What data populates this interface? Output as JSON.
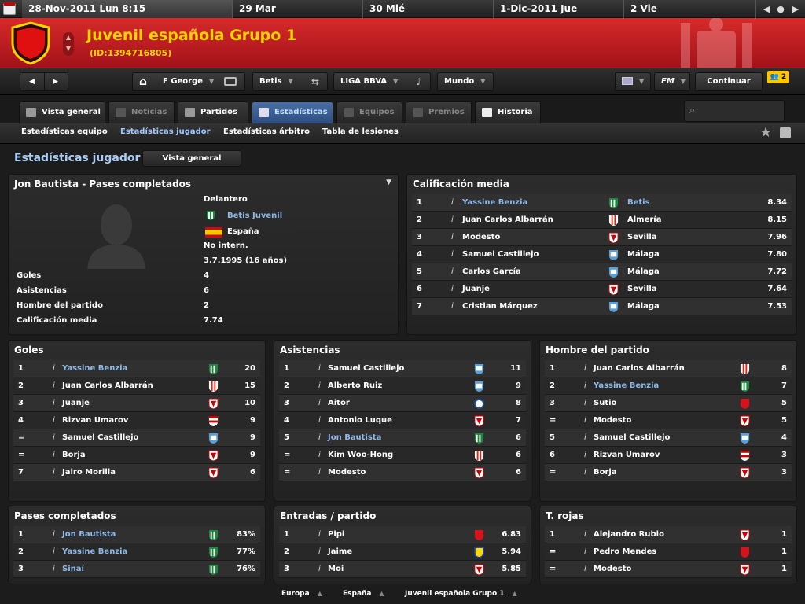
{
  "topbar": {
    "today": "28-Nov-2011 Lun 8:15",
    "dates": [
      "29 Mar",
      "30 Mié",
      "1-Dic-2011 Jue",
      "2 Vie"
    ]
  },
  "header": {
    "title": "Juvenil española Grupo 1",
    "id": "(ID:1394716805)"
  },
  "nav": {
    "manager": "F George",
    "club": "Betis",
    "league": "LIGA BBVA",
    "world": "Mundo",
    "fm": "FM",
    "continue": "Continuar",
    "badge": "2"
  },
  "tabs": [
    {
      "label": "Vista general",
      "icon": "list-icon"
    },
    {
      "label": "Noticias",
      "icon": "news-icon"
    },
    {
      "label": "Partidos",
      "icon": "calendar-icon"
    },
    {
      "label": "Estadísticas",
      "icon": "chart-icon"
    },
    {
      "label": "Equipos",
      "icon": "shield-icon"
    },
    {
      "label": "Premios",
      "icon": "trophy-icon"
    },
    {
      "label": "Historia",
      "icon": "book-icon"
    }
  ],
  "subtabs": [
    "Estadísticas equipo",
    "Estadísticas jugador",
    "Estadísticas árbitro",
    "Tabla de lesiones"
  ],
  "section": {
    "title": "Estadísticas jugador",
    "button": "Vista general"
  },
  "player": {
    "title": "Jon Bautista - Pases completados",
    "position": "Delantero",
    "club": "Betis Juvenil",
    "nation": "España",
    "intl": "No intern.",
    "dob": "3.7.1995 (16 años)",
    "stats": [
      {
        "label": "Goles",
        "value": "4"
      },
      {
        "label": "Asistencias",
        "value": "6"
      },
      {
        "label": "Hombre del partido",
        "value": "2"
      },
      {
        "label": "Calificación media",
        "value": "7.74"
      }
    ]
  },
  "rating": {
    "title": "Calificación media",
    "rows": [
      {
        "pos": "1",
        "name": "Yassine Benzia",
        "club": "Betis",
        "value": "8.34",
        "link": true,
        "crest": "betis"
      },
      {
        "pos": "2",
        "name": "Juan Carlos Albarrán",
        "club": "Almería",
        "value": "8.15",
        "link": false,
        "crest": "almeria"
      },
      {
        "pos": "3",
        "name": "Modesto",
        "club": "Sevilla",
        "value": "7.96",
        "link": false,
        "crest": "sevilla"
      },
      {
        "pos": "4",
        "name": "Samuel Castillejo",
        "club": "Málaga",
        "value": "7.80",
        "link": false,
        "crest": "malaga"
      },
      {
        "pos": "5",
        "name": "Carlos García",
        "club": "Málaga",
        "value": "7.72",
        "link": false,
        "crest": "malaga"
      },
      {
        "pos": "6",
        "name": "Juanje",
        "club": "Sevilla",
        "value": "7.64",
        "link": false,
        "crest": "sevilla"
      },
      {
        "pos": "7",
        "name": "Cristian Márquez",
        "club": "Málaga",
        "value": "7.53",
        "link": false,
        "crest": "malaga"
      }
    ]
  },
  "tables": [
    {
      "title": "Goles",
      "rows": [
        {
          "pos": "1",
          "name": "Yassine Benzia",
          "value": "20",
          "link": true,
          "crest": "betis"
        },
        {
          "pos": "2",
          "name": "Juan Carlos Albarrán",
          "value": "15",
          "link": false,
          "crest": "almeria"
        },
        {
          "pos": "3",
          "name": "Juanje",
          "value": "10",
          "link": false,
          "crest": "sevilla"
        },
        {
          "pos": "4",
          "name": "Rizvan Umarov",
          "value": "9",
          "link": false,
          "crest": "granada"
        },
        {
          "pos": "=",
          "name": "Samuel Castillejo",
          "value": "9",
          "link": false,
          "crest": "malaga"
        },
        {
          "pos": "=",
          "name": "Borja",
          "value": "9",
          "link": false,
          "crest": "sevilla"
        },
        {
          "pos": "7",
          "name": "Jairo Morilla",
          "value": "6",
          "link": false,
          "crest": "sevilla"
        }
      ]
    },
    {
      "title": "Asistencias",
      "rows": [
        {
          "pos": "1",
          "name": "Samuel Castillejo",
          "value": "11",
          "link": false,
          "crest": "malaga"
        },
        {
          "pos": "2",
          "name": "Alberto Ruiz",
          "value": "9",
          "link": false,
          "crest": "malaga"
        },
        {
          "pos": "3",
          "name": "Aitor",
          "value": "8",
          "link": false,
          "crest": "recre"
        },
        {
          "pos": "4",
          "name": "Antonio Luque",
          "value": "7",
          "link": false,
          "crest": "sevilla"
        },
        {
          "pos": "5",
          "name": "Jon Bautista",
          "value": "6",
          "link": true,
          "crest": "betis"
        },
        {
          "pos": "=",
          "name": "Kim Woo-Hong",
          "value": "6",
          "link": false,
          "crest": "almeria"
        },
        {
          "pos": "=",
          "name": "Modesto",
          "value": "6",
          "link": false,
          "crest": "sevilla"
        }
      ]
    },
    {
      "title": "Hombre del partido",
      "rows": [
        {
          "pos": "1",
          "name": "Juan Carlos Albarrán",
          "value": "8",
          "link": false,
          "crest": "almeria"
        },
        {
          "pos": "2",
          "name": "Yassine Benzia",
          "value": "7",
          "link": true,
          "crest": "betis"
        },
        {
          "pos": "3",
          "name": "Sutio",
          "value": "5",
          "link": false,
          "crest": "red"
        },
        {
          "pos": "=",
          "name": "Modesto",
          "value": "5",
          "link": false,
          "crest": "sevilla"
        },
        {
          "pos": "5",
          "name": "Samuel Castillejo",
          "value": "4",
          "link": false,
          "crest": "malaga"
        },
        {
          "pos": "6",
          "name": "Rizvan Umarov",
          "value": "3",
          "link": false,
          "crest": "granada"
        },
        {
          "pos": "=",
          "name": "Borja",
          "value": "3",
          "link": false,
          "crest": "sevilla"
        }
      ]
    },
    {
      "title": "Pases completados",
      "rows": [
        {
          "pos": "1",
          "name": "Jon Bautista",
          "value": "83%",
          "link": true,
          "crest": "betis"
        },
        {
          "pos": "2",
          "name": "Yassine Benzia",
          "value": "77%",
          "link": true,
          "crest": "betis"
        },
        {
          "pos": "3",
          "name": "Sinaí",
          "value": "76%",
          "link": true,
          "crest": "betis"
        }
      ]
    },
    {
      "title": "Entradas / partido",
      "rows": [
        {
          "pos": "1",
          "name": "Pipi",
          "value": "6.83",
          "link": false,
          "crest": "red"
        },
        {
          "pos": "2",
          "name": "Jaime",
          "value": "5.94",
          "link": false,
          "crest": "cadiz"
        },
        {
          "pos": "3",
          "name": "Moi",
          "value": "5.85",
          "link": false,
          "crest": "sevilla"
        }
      ]
    },
    {
      "title": "T. rojas",
      "rows": [
        {
          "pos": "1",
          "name": "Alejandro Rubio",
          "value": "1",
          "link": false,
          "crest": "sevilla"
        },
        {
          "pos": "=",
          "name": "Pedro Mendes",
          "value": "1",
          "link": false,
          "crest": "red"
        },
        {
          "pos": "=",
          "name": "Modesto",
          "value": "1",
          "link": false,
          "crest": "sevilla"
        }
      ]
    }
  ],
  "footer": [
    "Europa",
    "España",
    "Juvenil española Grupo 1"
  ],
  "colors": {
    "accent": "#ffd200",
    "header_red": "#c31f24",
    "link": "#8eb8e6",
    "active_tab": "#3b5f96"
  }
}
